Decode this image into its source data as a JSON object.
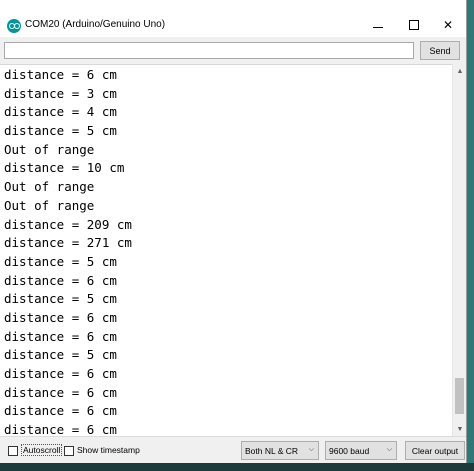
{
  "window": {
    "title": "COM20 (Arduino/Genuino Uno)",
    "icon": "arduino-icon",
    "controls": {
      "minimize": "minimize-icon",
      "maximize": "maximize-icon",
      "close_glyph": "✕"
    }
  },
  "toolbar": {
    "input_value": "",
    "send_label": "Send"
  },
  "output": {
    "lines": [
      "distance = 6 cm",
      "distance = 3 cm",
      "distance = 4 cm",
      "distance = 5 cm",
      "Out of range",
      "distance = 10 cm",
      "Out of range",
      "Out of range",
      "distance = 209 cm",
      "distance = 271 cm",
      "distance = 5 cm",
      "distance = 6 cm",
      "distance = 5 cm",
      "distance = 6 cm",
      "distance = 6 cm",
      "distance = 5 cm",
      "distance = 6 cm",
      "distance = 6 cm",
      "distance = 6 cm",
      "distance = 6 cm"
    ]
  },
  "statusbar": {
    "autoscroll_label": "Autoscroll",
    "autoscroll_checked": false,
    "timestamp_label": "Show timestamp",
    "timestamp_checked": false,
    "line_ending": "Both NL & CR",
    "baud_rate": "9600 baud",
    "clear_label": "Clear output"
  },
  "colors": {
    "accent": "#00979c",
    "window_bg": "#f0f0f0",
    "output_bg": "#ffffff"
  }
}
